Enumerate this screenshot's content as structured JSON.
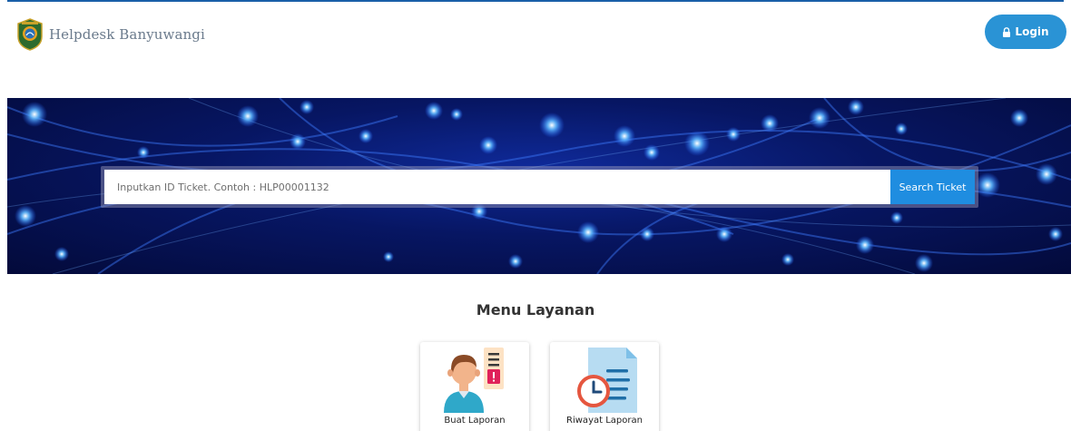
{
  "header": {
    "brand_name": "Helpdesk Banyuwangi",
    "logo_icon": "banyuwangi-emblem-icon",
    "login_label": "Login",
    "login_icon": "lock-icon",
    "accent_color": "#2a93d5"
  },
  "search": {
    "placeholder": "Inputkan ID Ticket. Contoh : HLP00001132",
    "button_label": "Search Ticket"
  },
  "services": {
    "title": "Menu Layanan",
    "items": [
      {
        "label": "Buat Laporan",
        "icon": "user-report-icon"
      },
      {
        "label": "Riwayat Laporan",
        "icon": "document-history-icon"
      }
    ]
  }
}
